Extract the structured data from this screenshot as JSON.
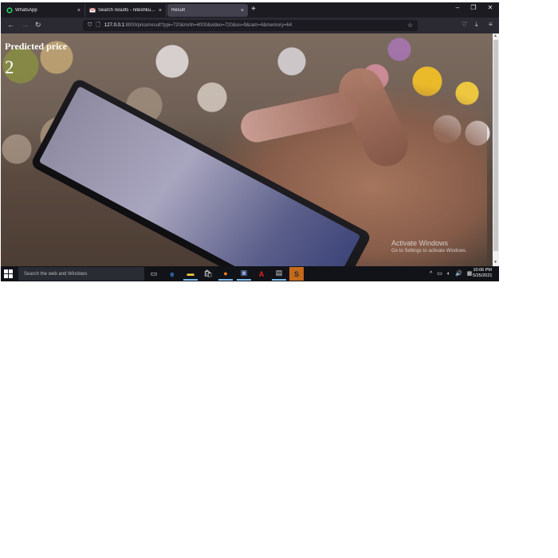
{
  "browser": {
    "tabs": [
      {
        "label": "WhatsApp",
        "icon": "whatsapp-icon",
        "close": "×"
      },
      {
        "label": "Search results - niteshkumar@...",
        "icon": "gmail-icon",
        "close": "×"
      },
      {
        "label": "Result",
        "icon": "",
        "close": "×"
      }
    ],
    "new_tab": "+",
    "window_controls": {
      "minimize": "–",
      "restore": "❐",
      "close": "✕"
    },
    "nav": {
      "back": "←",
      "forward": "→",
      "reload": "↻"
    },
    "url_host": "127.0.0.1",
    "url_rest": ":8000/price/result?ppi=720&mAh=4000&video=720&os=9&ram=4&memory=64",
    "icons": {
      "shield": "⛉",
      "page": "🗋",
      "star": "☆",
      "pocket": "♡",
      "download": "⤓",
      "menu": "≡"
    }
  },
  "page": {
    "heading": "Predicted price",
    "value": "2"
  },
  "watermark": {
    "title": "Activate Windows",
    "subtitle": "Go to Settings to activate Windows."
  },
  "taskbar": {
    "search_placeholder": "Search the web and Windows",
    "apps": [
      {
        "name": "task-view-icon",
        "glyph": "▭"
      },
      {
        "name": "edge-icon",
        "glyph": "e"
      },
      {
        "name": "file-explorer-icon",
        "glyph": "▬"
      },
      {
        "name": "store-icon",
        "glyph": "🛍"
      },
      {
        "name": "firefox-icon",
        "glyph": "●"
      },
      {
        "name": "remote-desktop-icon",
        "glyph": "▣"
      },
      {
        "name": "acrobat-icon",
        "glyph": "A"
      },
      {
        "name": "terminal-icon",
        "glyph": "▤"
      },
      {
        "name": "sublime-icon",
        "glyph": "S"
      }
    ],
    "tray_icons": "^ ▭ ◐ 🔊 ▦",
    "time": "10:06 PM",
    "date": "5/25/2021"
  },
  "colors": {
    "browser_bg": "#1c1b22",
    "active_tab": "#42414d",
    "taskbar": "#111318",
    "sublime_highlight": "#c56a1d"
  }
}
